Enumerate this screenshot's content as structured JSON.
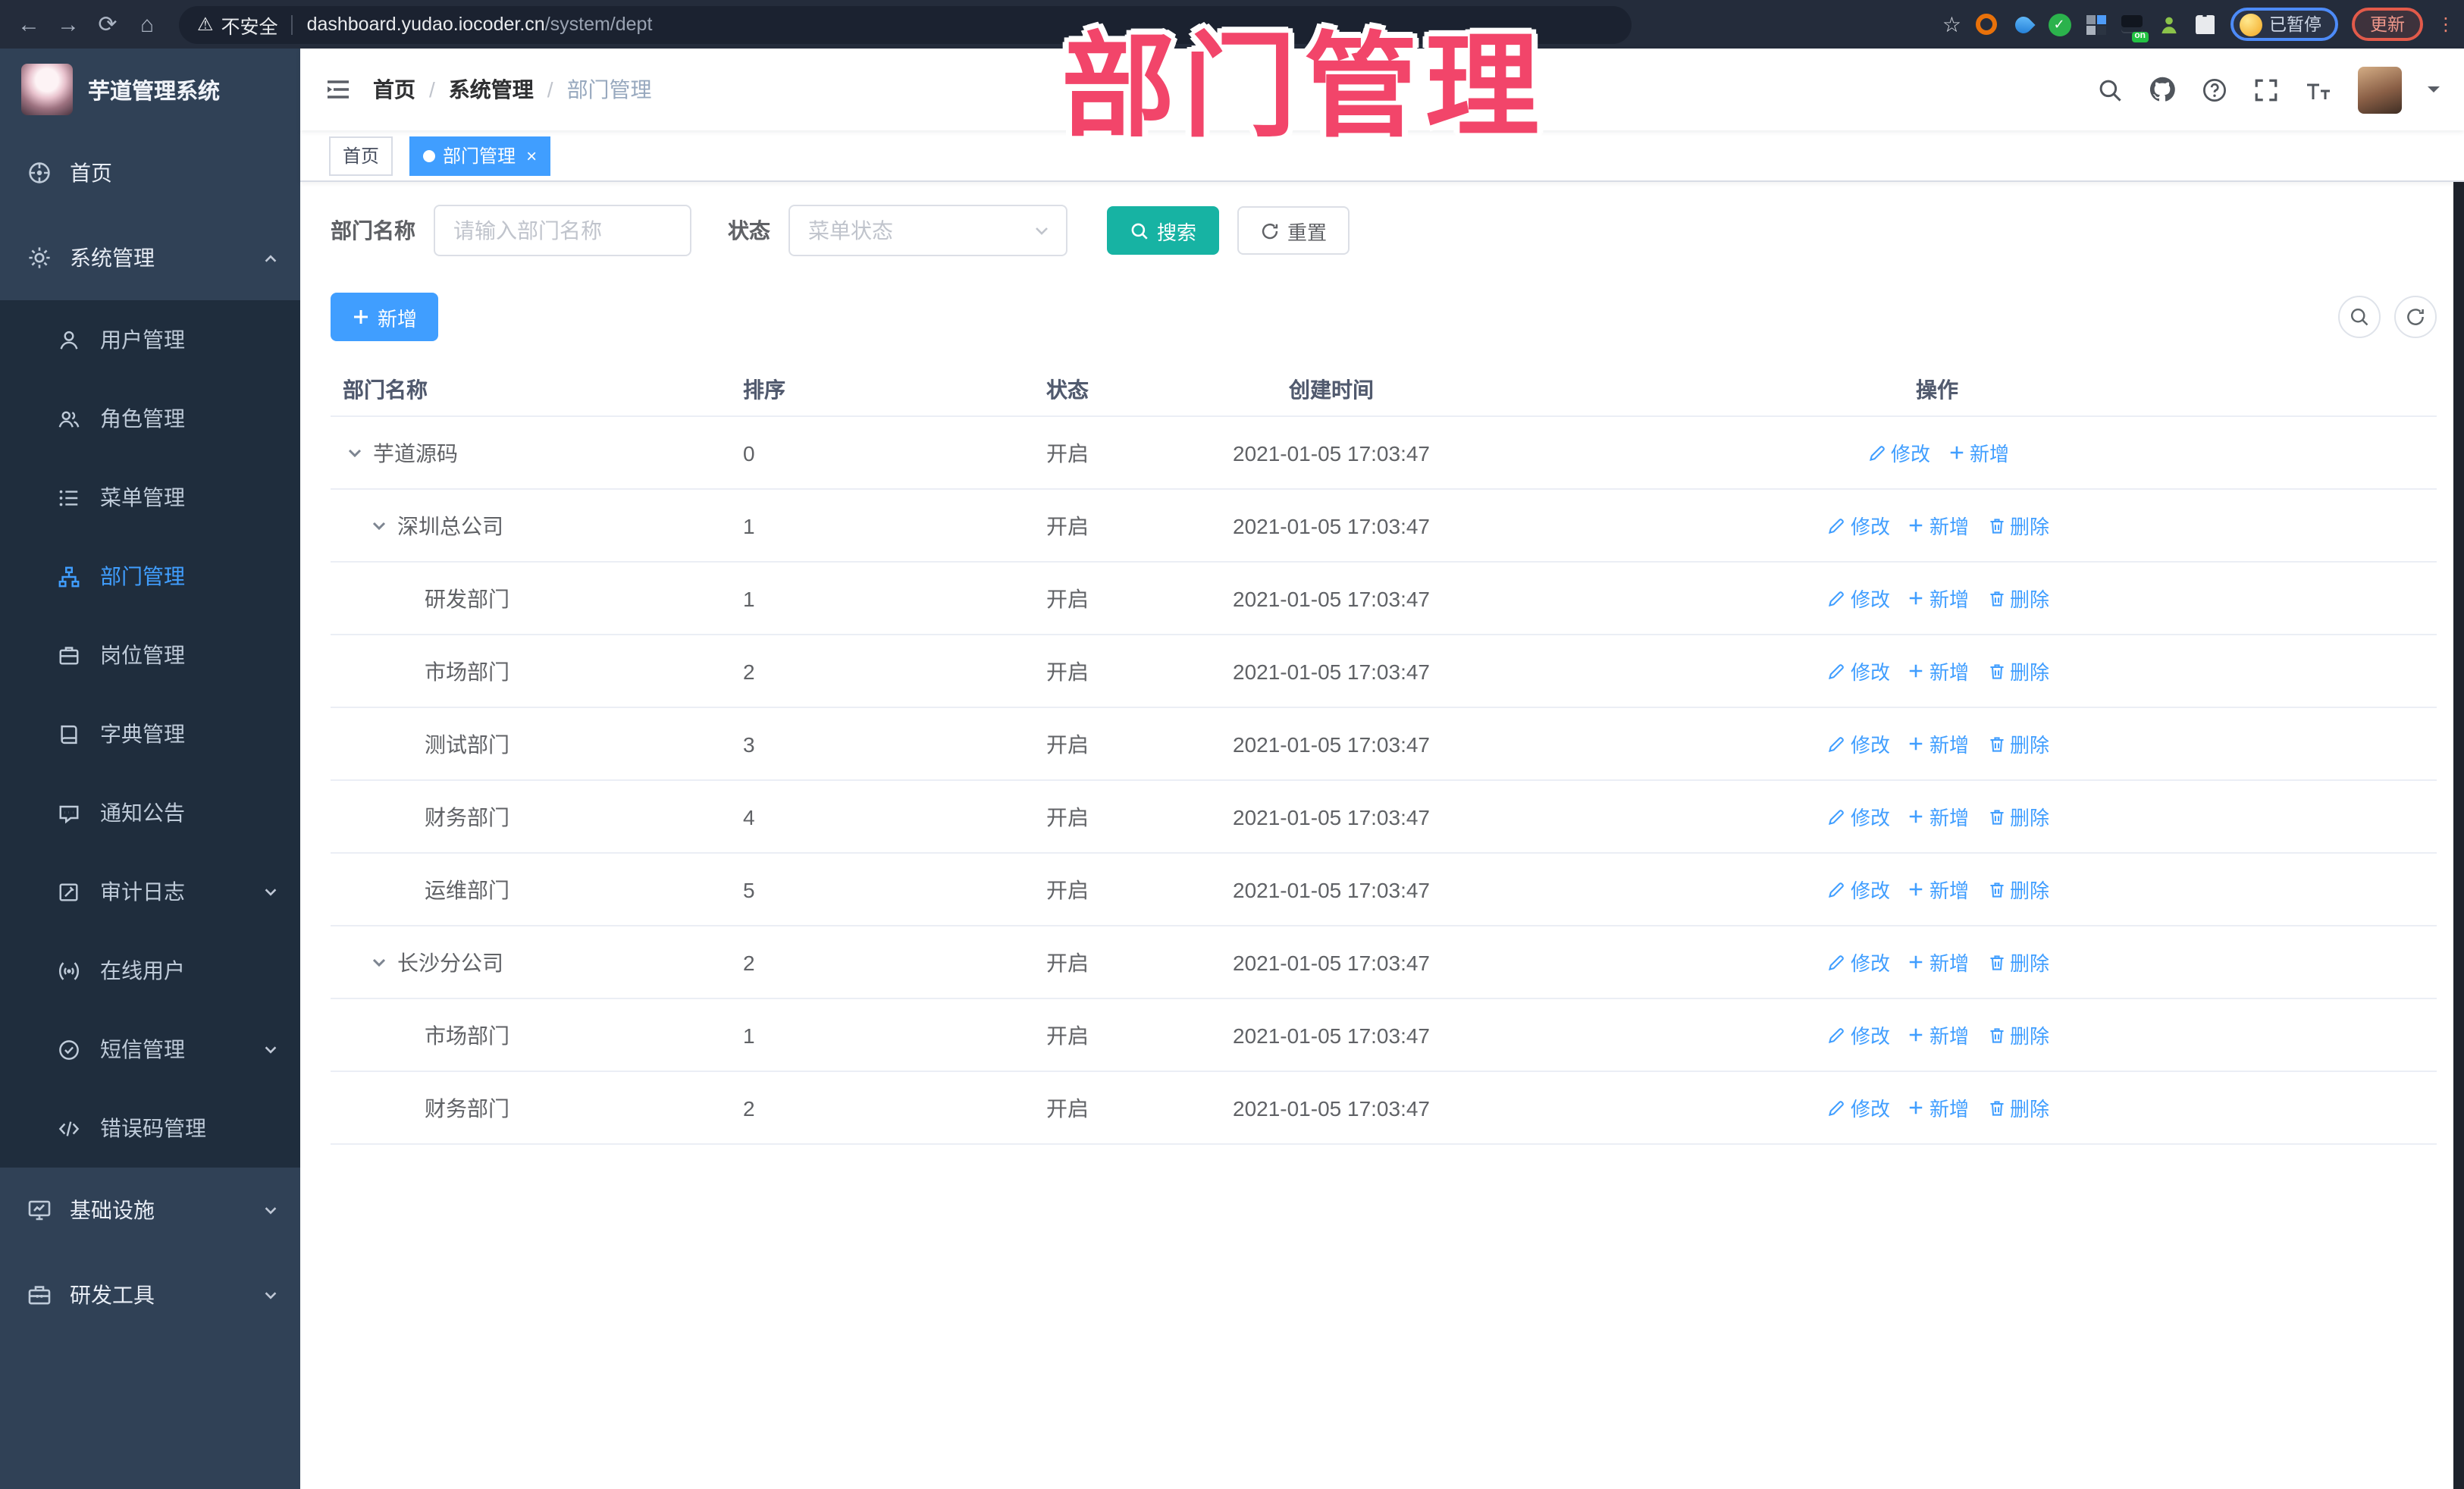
{
  "browser": {
    "security_label": "不安全",
    "url_host": "dashboard.yudao.iocoder.cn",
    "url_path": "/system/dept",
    "extension_badge": "on",
    "profile_status": "已暂停",
    "update_label": "更新",
    "menu_dots": "⋮"
  },
  "overlay": {
    "title": "部门管理"
  },
  "app": {
    "title": "芋道管理系统"
  },
  "sidebar": {
    "items": [
      {
        "label": "首页"
      },
      {
        "label": "系统管理"
      },
      {
        "label": "用户管理"
      },
      {
        "label": "角色管理"
      },
      {
        "label": "菜单管理"
      },
      {
        "label": "部门管理"
      },
      {
        "label": "岗位管理"
      },
      {
        "label": "字典管理"
      },
      {
        "label": "通知公告"
      },
      {
        "label": "审计日志"
      },
      {
        "label": "在线用户"
      },
      {
        "label": "短信管理"
      },
      {
        "label": "错误码管理"
      },
      {
        "label": "基础设施"
      },
      {
        "label": "研发工具"
      }
    ]
  },
  "breadcrumb": {
    "items": [
      "首页",
      "系统管理",
      "部门管理"
    ]
  },
  "tags": {
    "home": "首页",
    "current": "部门管理",
    "close": "×"
  },
  "filters": {
    "name_label": "部门名称",
    "name_placeholder": "请输入部门名称",
    "status_label": "状态",
    "status_placeholder": "菜单状态",
    "search": "搜索",
    "reset": "重置"
  },
  "toolbar": {
    "add": "新增"
  },
  "table": {
    "headers": [
      "部门名称",
      "排序",
      "状态",
      "创建时间",
      "操作"
    ],
    "actions": {
      "edit": "修改",
      "add": "新增",
      "delete": "删除"
    },
    "rows": [
      {
        "name": "芋道源码",
        "sort": "0",
        "status": "开启",
        "created": "2021-01-05 17:03:47"
      },
      {
        "name": "深圳总公司",
        "sort": "1",
        "status": "开启",
        "created": "2021-01-05 17:03:47"
      },
      {
        "name": "研发部门",
        "sort": "1",
        "status": "开启",
        "created": "2021-01-05 17:03:47"
      },
      {
        "name": "市场部门",
        "sort": "2",
        "status": "开启",
        "created": "2021-01-05 17:03:47"
      },
      {
        "name": "测试部门",
        "sort": "3",
        "status": "开启",
        "created": "2021-01-05 17:03:47"
      },
      {
        "name": "财务部门",
        "sort": "4",
        "status": "开启",
        "created": "2021-01-05 17:03:47"
      },
      {
        "name": "运维部门",
        "sort": "5",
        "status": "开启",
        "created": "2021-01-05 17:03:47"
      },
      {
        "name": "长沙分公司",
        "sort": "2",
        "status": "开启",
        "created": "2021-01-05 17:03:47"
      },
      {
        "name": "市场部门",
        "sort": "1",
        "status": "开启",
        "created": "2021-01-05 17:03:47"
      },
      {
        "name": "财务部门",
        "sort": "2",
        "status": "开启",
        "created": "2021-01-05 17:03:47"
      }
    ]
  },
  "colors": {
    "accent": "#409EFF",
    "search_button": "#17b3a3",
    "overlay_title": "#f2456a",
    "sidebar_bg": "#304156",
    "submenu_bg": "#1f2d3d"
  }
}
